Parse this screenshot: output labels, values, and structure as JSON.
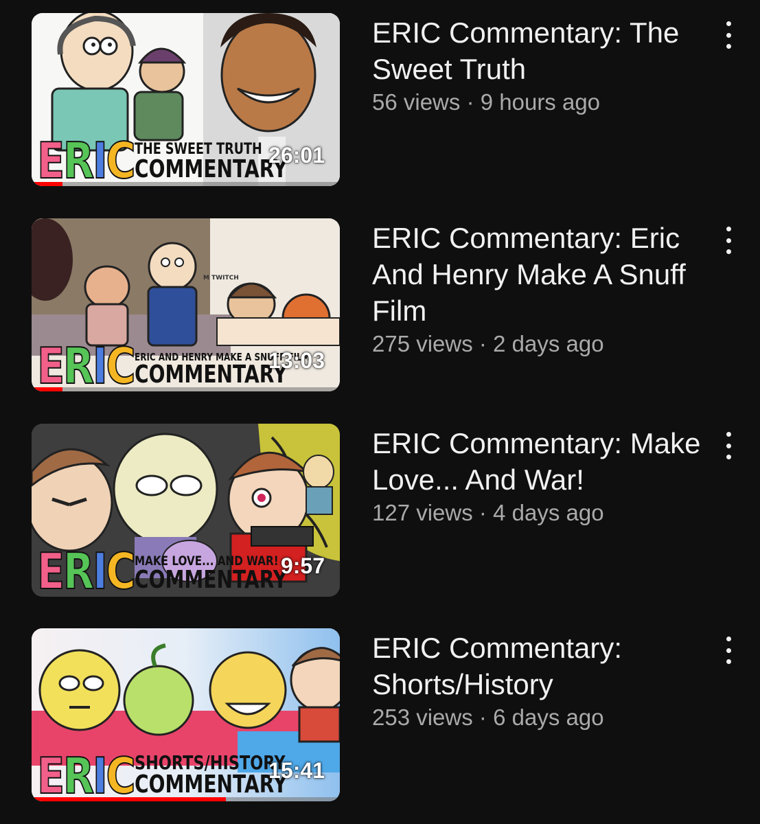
{
  "colors": {
    "background": "#0f0f0f",
    "title_text": "#f1f1f1",
    "meta_text": "#aaaaaa",
    "progress": "#ff0000"
  },
  "videos": [
    {
      "title": "ERIC Commentary: The Sweet Truth",
      "views": "56 views",
      "sep": "·",
      "age": "9 hours ago",
      "duration": "26:01",
      "watched_fraction": 0.1,
      "thumb_subtitle": "THE SWEET TRUTH",
      "thumb_brand": "COMMENTARY",
      "thumb_logo": [
        "E",
        "R",
        "I",
        "C"
      ],
      "menu_icon": "more-vertical-icon"
    },
    {
      "title": "ERIC Commentary: Eric And Henry Make A Snuff Film",
      "views": "275 views",
      "sep": "·",
      "age": "2 days ago",
      "duration": "13:03",
      "watched_fraction": 0.1,
      "thumb_subtitle": "ERIC AND HENRY MAKE A SNUFF FILM",
      "thumb_brand": "COMMENTARY",
      "thumb_logo": [
        "E",
        "R",
        "I",
        "C"
      ],
      "thumb_caption": "M TWITCH",
      "menu_icon": "more-vertical-icon"
    },
    {
      "title": "ERIC Commentary: Make Love... And War!",
      "views": "127 views",
      "sep": "·",
      "age": "4 days ago",
      "duration": "9:57",
      "watched_fraction": 0,
      "thumb_subtitle": "MAKE LOVE... AND WAR!",
      "thumb_brand": "COMMENTARY",
      "thumb_logo": [
        "E",
        "R",
        "I",
        "C"
      ],
      "menu_icon": "more-vertical-icon"
    },
    {
      "title": "ERIC Commentary: Shorts/History",
      "views": "253 views",
      "sep": "·",
      "age": "6 days ago",
      "duration": "15:41",
      "watched_fraction": 0.63,
      "thumb_subtitle": "SHORTS/HISTORY",
      "thumb_brand": "COMMENTARY",
      "thumb_logo": [
        "E",
        "R",
        "I",
        "C"
      ],
      "menu_icon": "more-vertical-icon"
    }
  ]
}
